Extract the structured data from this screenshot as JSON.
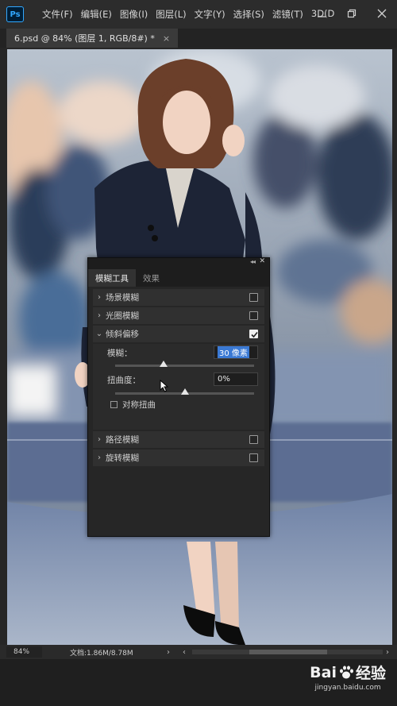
{
  "app": {
    "logo_text": "Ps"
  },
  "menu": [
    "文件(F)",
    "编辑(E)",
    "图像(I)",
    "图层(L)",
    "文字(Y)",
    "选择(S)",
    "滤镜(T)",
    "3D(D"
  ],
  "document_tab": {
    "label": "6.psd @ 84% (图层 1, RGB/8#) *",
    "close": "×"
  },
  "blur_panel": {
    "tabs": [
      "模糊工具",
      "效果"
    ],
    "active_tab": "模糊工具",
    "sections": [
      {
        "title": "场景模糊",
        "expanded": false,
        "checked": false
      },
      {
        "title": "光圈模糊",
        "expanded": false,
        "checked": false
      },
      {
        "title": "倾斜偏移",
        "expanded": true,
        "checked": true
      },
      {
        "title": "路径模糊",
        "expanded": false,
        "checked": false
      },
      {
        "title": "旋转模糊",
        "expanded": false,
        "checked": false
      }
    ],
    "tilt_shift": {
      "blur_label": "模糊：",
      "blur_value": "30 像素",
      "blur_slider": 0.35,
      "distortion_label": "扭曲度：",
      "distortion_value": "0%",
      "distortion_slider": 0.5,
      "symmetric_label": "对称扭曲",
      "symmetric_checked": false
    }
  },
  "status": {
    "zoom": "84%",
    "doc_info": "文档:1.86M/8.78M"
  },
  "watermark": {
    "brand_left": "Bai",
    "brand_right": "经验",
    "url": "jingyan.baidu.com"
  },
  "colors": {
    "ps_blue": "#31a8ff",
    "selection": "#3a79d4"
  }
}
